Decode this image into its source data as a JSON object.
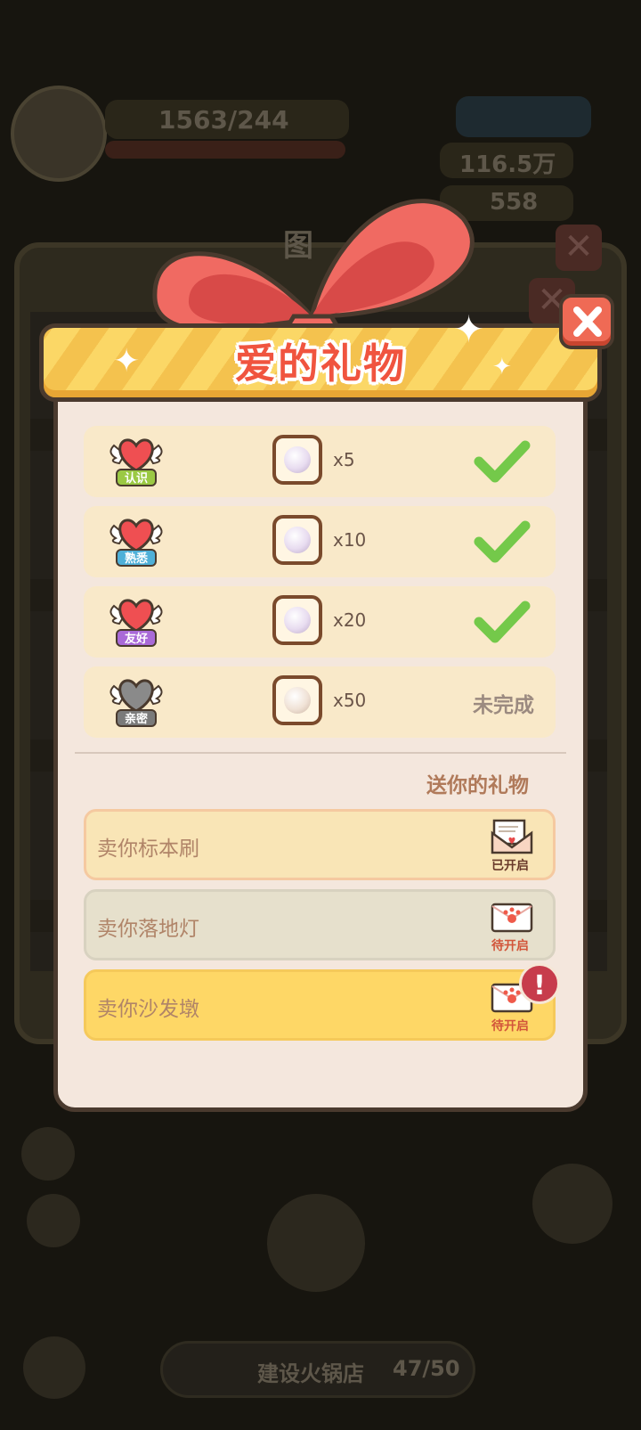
{
  "background": {
    "resource_counter": "1563/244",
    "currency_1": "116.5万",
    "currency_2": "558",
    "panel_title_fragment": "图",
    "bottom_task": "建设火锅店",
    "bottom_progress": "47/50"
  },
  "dialog": {
    "title": "爱的礼物",
    "milestones": [
      {
        "badge": "认识",
        "qty": "x5",
        "done": true
      },
      {
        "badge": "熟悉",
        "qty": "x10",
        "done": true
      },
      {
        "badge": "友好",
        "qty": "x20",
        "done": true
      },
      {
        "badge": "亲密",
        "qty": "x50",
        "done": false,
        "status": "未完成"
      }
    ],
    "gifts_section_title": "送你的礼物",
    "gifts": [
      {
        "label": "卖你标本刷",
        "status": "已开启"
      },
      {
        "label": "卖你落地灯",
        "status": "待开启"
      },
      {
        "label": "卖你沙发墩",
        "status": "待开启",
        "alert": "!"
      }
    ]
  },
  "colors": {
    "title_red": "#f0543f",
    "banner_yellow": "#fbd766",
    "check_green": "#74c94a",
    "alert_red": "#c73c4c"
  },
  "icons": [
    "heart-wings-icon",
    "pearl-icon",
    "check-icon",
    "envelope-icon",
    "close-icon",
    "sparkle-icon"
  ]
}
